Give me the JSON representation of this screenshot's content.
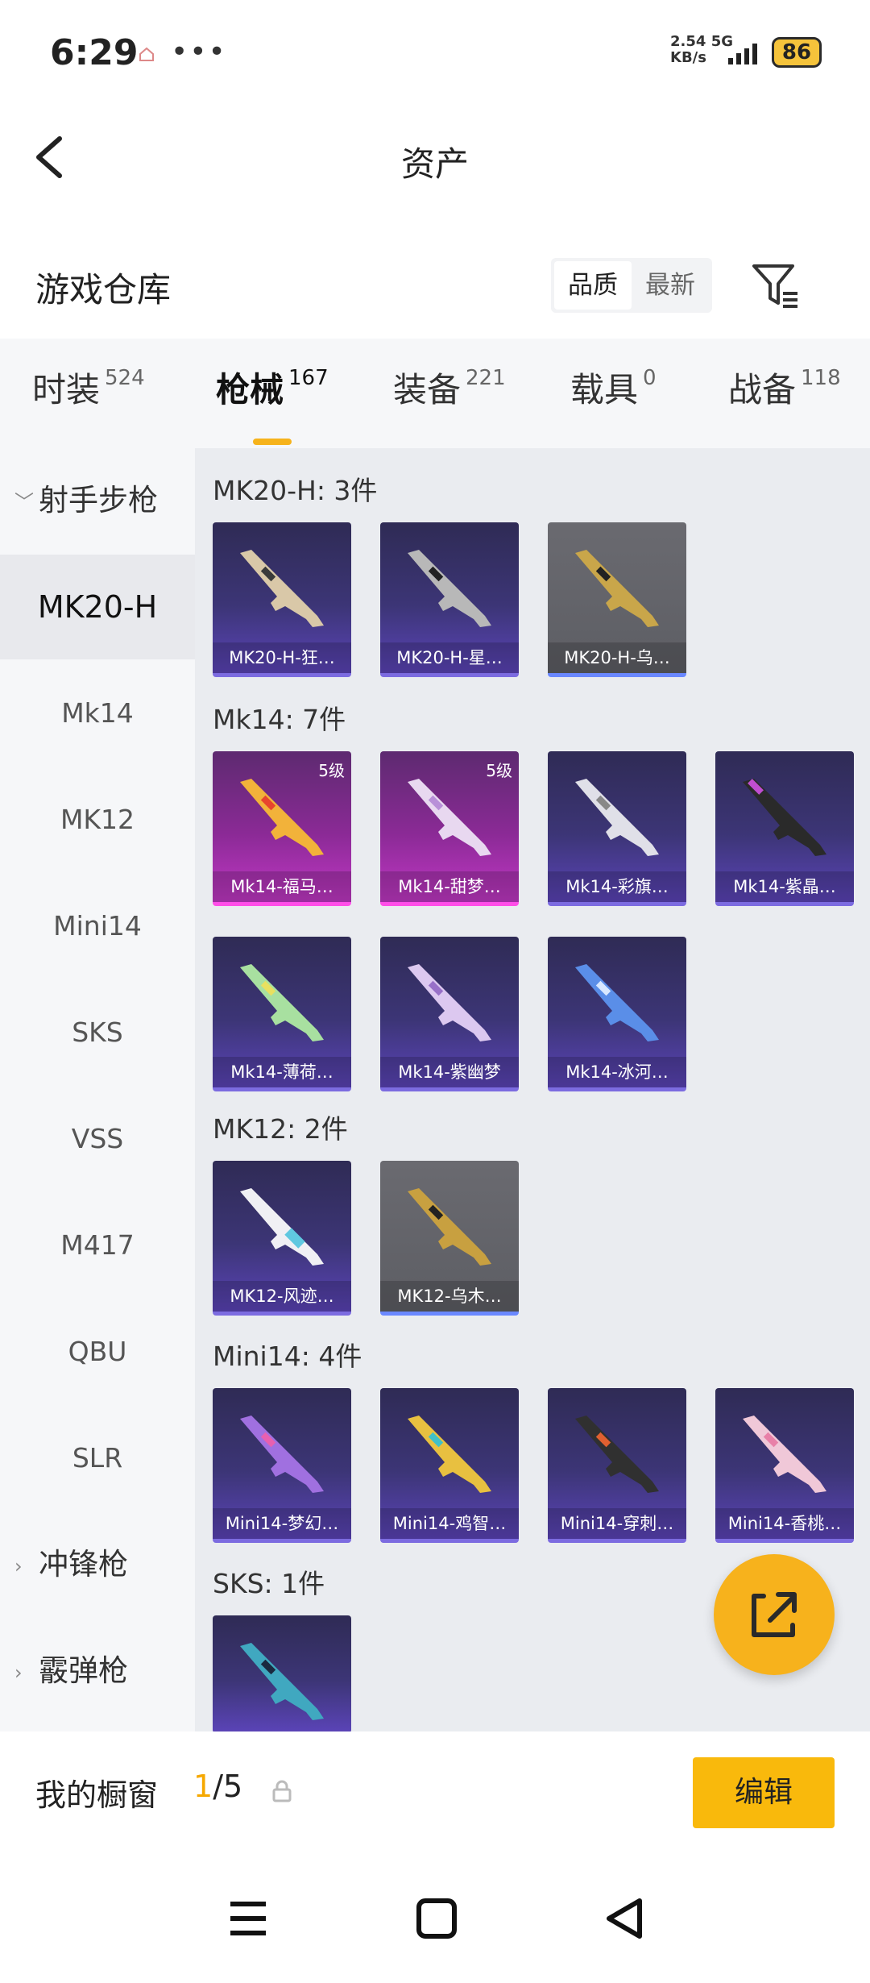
{
  "status": {
    "time": "6:29",
    "net_speed": "2.54",
    "net_unit": "KB/s",
    "net_type": "5G",
    "battery": "86"
  },
  "header": {
    "title": "资产"
  },
  "warehouse": {
    "label": "游戏仓库",
    "sort_quality": "品质",
    "sort_newest": "最新"
  },
  "tabs": [
    {
      "name": "时装",
      "count": "524"
    },
    {
      "name": "枪械",
      "count": "167"
    },
    {
      "name": "装备",
      "count": "221"
    },
    {
      "name": "载具",
      "count": "0"
    },
    {
      "name": "战备",
      "count": "118"
    }
  ],
  "sidebar": {
    "group_dmr": "射手步枪",
    "items": [
      "MK20-H",
      "Mk14",
      "MK12",
      "Mini14",
      "SKS",
      "VSS",
      "M417",
      "QBU",
      "SLR"
    ],
    "group_smg": "冲锋枪",
    "group_shotgun": "霰弹枪"
  },
  "sections": [
    {
      "title": "MK20-H: 3件",
      "cards": [
        {
          "name": "MK20-H-狂…",
          "rarity": "purple"
        },
        {
          "name": "MK20-H-星…",
          "rarity": "purple"
        },
        {
          "name": "MK20-H-乌…",
          "rarity": "gray"
        }
      ]
    },
    {
      "title": "Mk14: 7件",
      "cards": [
        {
          "name": "Mk14-福马…",
          "rarity": "pink",
          "level": "5级"
        },
        {
          "name": "Mk14-甜梦…",
          "rarity": "pink",
          "level": "5级"
        },
        {
          "name": "Mk14-彩旗…",
          "rarity": "purple"
        },
        {
          "name": "Mk14-紫晶…",
          "rarity": "purple"
        },
        {
          "name": "Mk14-薄荷…",
          "rarity": "purple"
        },
        {
          "name": "Mk14-紫幽梦",
          "rarity": "purple"
        },
        {
          "name": "Mk14-冰河…",
          "rarity": "purple"
        }
      ]
    },
    {
      "title": "MK12: 2件",
      "cards": [
        {
          "name": "MK12-风迹…",
          "rarity": "purple"
        },
        {
          "name": "MK12-乌木…",
          "rarity": "gray"
        }
      ]
    },
    {
      "title": "Mini14: 4件",
      "cards": [
        {
          "name": "Mini14-梦幻…",
          "rarity": "purple"
        },
        {
          "name": "Mini14-鸡智…",
          "rarity": "purple"
        },
        {
          "name": "Mini14-穿刺…",
          "rarity": "purple"
        },
        {
          "name": "Mini14-香桃…",
          "rarity": "purple"
        }
      ]
    },
    {
      "title": "SKS: 1件",
      "cards": [
        {
          "name": "",
          "rarity": "purple"
        }
      ]
    }
  ],
  "showcase": {
    "label": "我的橱窗",
    "current": "1",
    "total": "/5",
    "edit_label": "编辑"
  },
  "colors": {
    "accent": "#f9b90c",
    "purple_card": "#3c3576",
    "pink_card": "#8b2a96",
    "gray_card": "#5d5e64"
  }
}
